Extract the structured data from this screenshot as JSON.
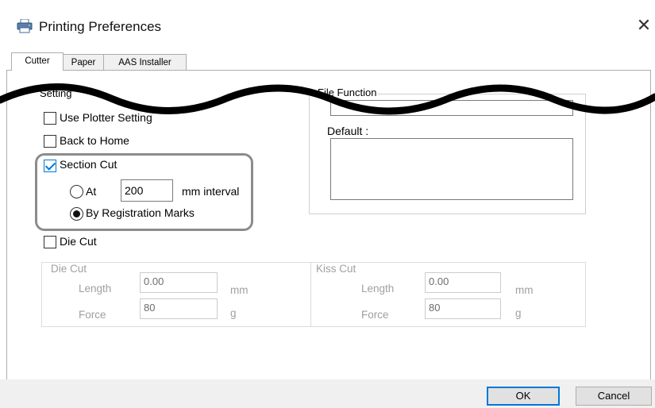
{
  "window": {
    "title": "Printing Preferences",
    "close_symbol": "✕"
  },
  "tabs": [
    {
      "label": "Cutter",
      "active": true
    },
    {
      "label": "Paper",
      "active": false
    },
    {
      "label": "AAS Installer",
      "active": false
    }
  ],
  "setting": {
    "group_label": "Setting",
    "use_plotter": {
      "label": "Use Plotter Setting",
      "checked": false
    },
    "back_to_home": {
      "label": "Back to Home",
      "checked": false
    },
    "section_cut": {
      "label": "Section Cut",
      "checked": true
    },
    "at": {
      "label": "At",
      "value": "200",
      "unit": "mm interval",
      "selected": false
    },
    "registration": {
      "label": "By Registration Marks",
      "selected": true
    },
    "die_cut": {
      "label": "Die Cut",
      "checked": false
    }
  },
  "file_function": {
    "group_label": "File Function",
    "default_label": "Default :"
  },
  "die_cut_group": {
    "group_label": "Die Cut",
    "length_label": "Length",
    "length_value": "0.00",
    "length_unit": "mm",
    "force_label": "Force",
    "force_value": "80",
    "force_unit": "g"
  },
  "kiss_cut_group": {
    "group_label": "Kiss Cut",
    "length_label": "Length",
    "length_value": "0.00",
    "length_unit": "mm",
    "force_label": "Force",
    "force_value": "80",
    "force_unit": "g"
  },
  "buttons": {
    "ok": "OK",
    "cancel": "Cancel"
  },
  "colors": {
    "accent": "#0078d7",
    "highlight_border": "#8c8c8c",
    "disabled_text": "#a0a0a0"
  },
  "icons": {
    "title_icon": "printer-icon"
  }
}
